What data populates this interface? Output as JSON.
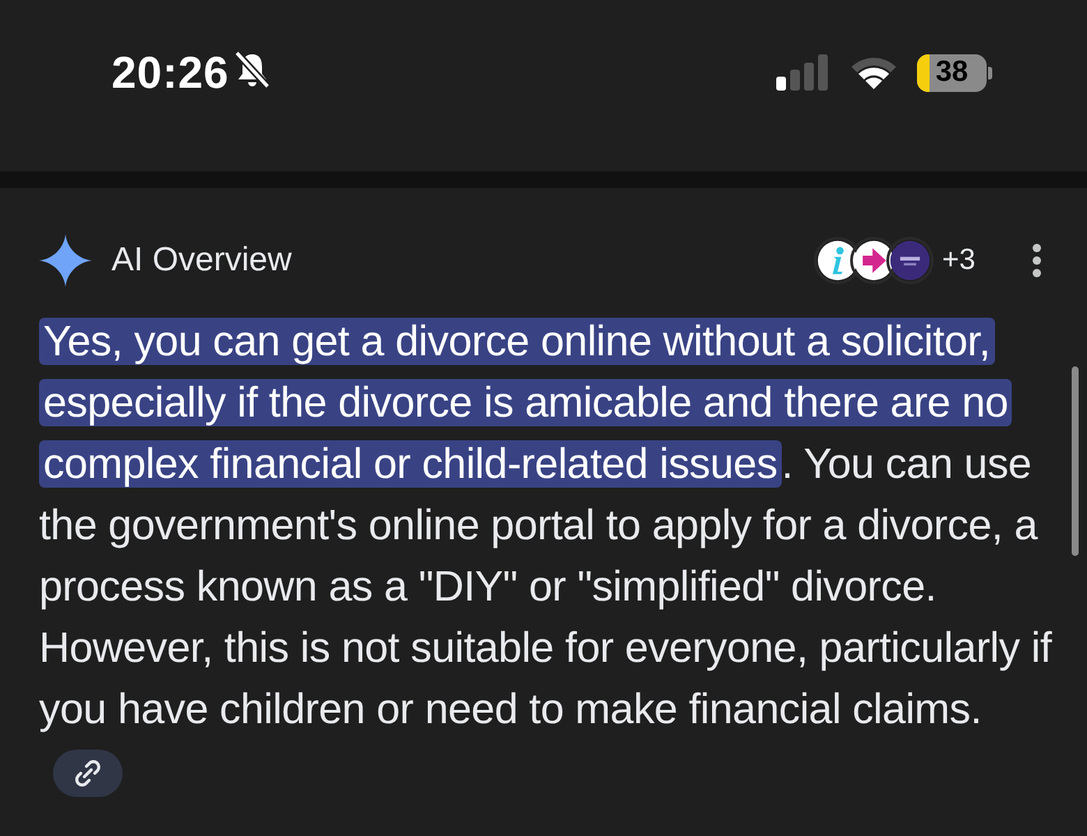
{
  "status_bar": {
    "time": "20:26",
    "silent": true,
    "battery": "38"
  },
  "overview": {
    "title": "AI Overview",
    "sources_more": "+3",
    "answer_highlighted": "Yes, you can get a divorce online without a solicitor, especially if the divorce is amicable and there are no complex financial or child-related issues",
    "answer_rest": ". You can use the government's online portal to apply for a divorce, a process known as a \"DIY\" or \"simplified\" divorce. However, this is not suitable for everyone, particularly if you have children or need to make financial claims."
  }
}
